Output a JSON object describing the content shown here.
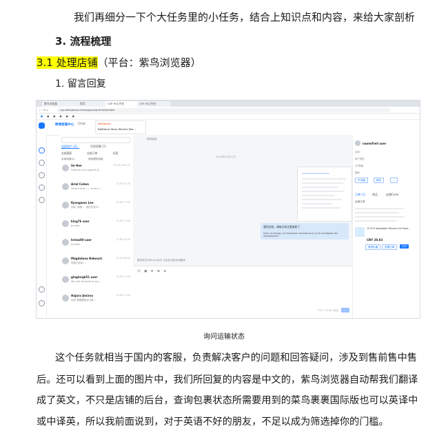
{
  "intro": "我们再细分一下个大任务里的小任务，结合上知识点和内容，来给大家剖析",
  "section_heading": "3. 流程梳理",
  "subsection": {
    "highlight": "3.1 处理店铺",
    "rest": "（平台：紫鸟浏览器）"
  },
  "item": "1. 留言回复",
  "caption": "询问运输状态",
  "paragraph_lines": [
    "这个任务就相当于国内的客服，负责解决客户的问题和回答疑问，涉及到售前售中售",
    "后。还可以看到上面的图片中，我们所回复的内容是中文的，紫鸟浏览器自动帮我们翻译",
    "成了英文，不只是店铺的后台，查询包裹状态所需要用到的菜鸟裹裹国际版也可以英译中",
    "或中译英，所以我前面说到，对于英语不好的朋友，不足以成为筛选掉你的门槛。"
  ],
  "screenshot": {
    "tabs": [
      "紫鸟浏览器",
      "首页",
      "CSP IM工作台",
      "CSP IM工作台"
    ],
    "url": "csp.aliexpress.com/apps/csp/im#/window",
    "app_title": "跨境客服中心",
    "app_tab": "Chat",
    "store_label": "AliExpress",
    "store_name": "BeBitoue Story Kitchen Bar...",
    "list_tabs": [
      "全部用户 (2)",
      "消息提醒 (2)"
    ],
    "filters": [
      "全部国家",
      "全部订单",
      "标签"
    ],
    "checkboxes": [
      "未读消息(0)",
      "待处理的消息"
    ],
    "contacts": [
      {
        "name": "Se Hee",
        "msg": "Hello do you support D...",
        "time": "13:08 2022-07",
        "initials": "Se"
      },
      {
        "name": "Ariel Cohen",
        "msg": "Hello friend, I ... order s...",
        "time": "11:09 70:35",
        "initials": ""
      },
      {
        "name": "Kyongwon Lee",
        "msg": "你好, 我想 ... 你们在电子...",
        "time": "11:09 77:00",
        "initials": ""
      },
      {
        "name": "king76 user",
        "msg": "[Invite]",
        "time": "11:09 77:00",
        "initials": ""
      },
      {
        "name": "hrima00 user",
        "msg": "[Invite]",
        "time": "11:09 70:35",
        "initials": ""
      },
      {
        "name": "Magdalena Rebesch",
        "msg": "包裹已收到 ...",
        "time": "11:09 00:00",
        "initials": ""
      },
      {
        "name": "gloglorg651 user",
        "msg": "We look forward to you...",
        "time": "11:09 77:00",
        "initials": ""
      },
      {
        "name": "Hajara Amiros",
        "msg": "你好 我想要购买订单...",
        "time": "11:09 77:00",
        "initials": ""
      }
    ],
    "chat_date": "2022年07月07日",
    "bubble_zh": "我到达啦，请每天你注意查收了",
    "bubble_en": "Hola, mi amigo, el transporte revisado que yo he entregado tan rápidamente.",
    "translate_hint": "要求发货对你nice也开 点击此切换自动翻译",
    "input_hint": "Ctrl + Enter 发送",
    "right_user": "naomifreil user",
    "right_tags": [
      "买家",
      "用户类型",
      "VIP等级",
      "国家"
    ],
    "right_buttons": [
      "不沟通",
      "邮件",
      "..."
    ],
    "order_tabs": [
      "订单 (1)",
      "商品",
      "店铺Code"
    ],
    "order_filter": "全部订单",
    "product": "12 PCS Adaptable Silicone Lid Food...",
    "price": "CNY 29.83",
    "order_buttons": [
      "修改价格",
      "查看订单",
      "打开"
    ]
  }
}
